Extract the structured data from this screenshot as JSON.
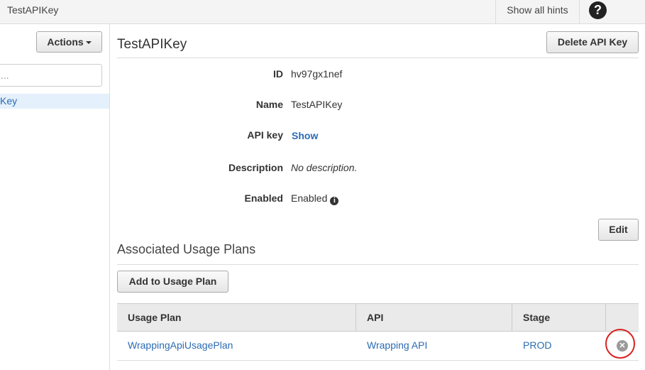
{
  "topbar": {
    "title": "TestAPIKey",
    "hints_label": "Show all hints",
    "help_glyph": "?"
  },
  "sidebar": {
    "actions_label": "Actions",
    "search_placeholder": "...",
    "items": [
      {
        "label": "Key",
        "selected": true
      }
    ]
  },
  "main": {
    "title": "TestAPIKey",
    "delete_label": "Delete API Key",
    "edit_label": "Edit",
    "fields": {
      "id": {
        "label": "ID",
        "value": "hv97gx1nef"
      },
      "name": {
        "label": "Name",
        "value": "TestAPIKey"
      },
      "api_key": {
        "label": "API key",
        "value": "Show"
      },
      "description": {
        "label": "Description",
        "value": "No description."
      },
      "enabled": {
        "label": "Enabled",
        "value": "Enabled",
        "icon": "info-icon"
      }
    }
  },
  "usage_plans": {
    "title": "Associated Usage Plans",
    "add_label": "Add to Usage Plan",
    "columns": [
      "Usage Plan",
      "API",
      "Stage"
    ],
    "rows": [
      {
        "usage_plan": "WrappingApiUsagePlan",
        "api": "Wrapping API",
        "stage": "PROD",
        "action_icon": "remove-icon"
      }
    ]
  },
  "colors": {
    "link": "#2b6bb4",
    "highlight_circle": "#d92121",
    "selected_item_bg": "#e4f0fb"
  }
}
